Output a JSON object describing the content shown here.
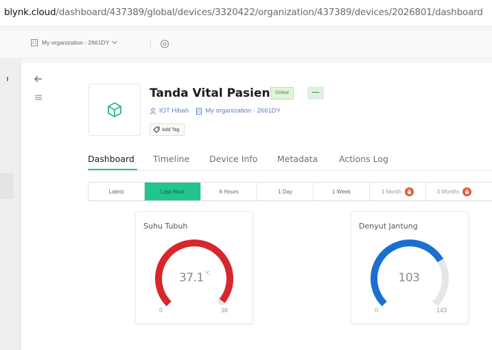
{
  "browser": {
    "url_host": "blynk.cloud",
    "url_path": "/dashboard/437389/global/devices/3320422/organization/437389/devices/2026801/dashboard"
  },
  "org_bar": {
    "org_name": "My organization - 2661DY",
    "icons": [
      "building-icon",
      "chevron-down-icon",
      "settings-icon"
    ]
  },
  "sidebar": {
    "icons": [
      "back-arrow-icon",
      "menu-icon"
    ]
  },
  "device": {
    "title": "Tanda Vital Pasien",
    "status": "Online",
    "more_label": "—",
    "owner": "IOT Hibah",
    "organization": "My organization - 2661DY",
    "add_tag_label": "Add Tag",
    "icon": "cube-icon"
  },
  "tabs": [
    {
      "label": "Dashboard",
      "active": true
    },
    {
      "label": "Timeline"
    },
    {
      "label": "Device Info"
    },
    {
      "label": "Metadata"
    },
    {
      "label": "Actions Log"
    }
  ],
  "time_ranges": [
    {
      "label": "Latest"
    },
    {
      "label": "Last Hour",
      "active": true
    },
    {
      "label": "6 Hours"
    },
    {
      "label": "1 Day"
    },
    {
      "label": "1 Week"
    },
    {
      "label": "1 Month",
      "locked": true
    },
    {
      "label": "3 Months",
      "locked": true
    }
  ],
  "widgets": [
    {
      "title": "Suhu Tubuh",
      "value": "37.1",
      "unit": "°C",
      "numeric_value": 37.1,
      "min": "0",
      "max": "38",
      "min_value": 0,
      "max_value": 38,
      "color": "#d7262c"
    },
    {
      "title": "Denyut Jantung",
      "value": "103",
      "unit": "",
      "numeric_value": 103,
      "min": "0",
      "max": "143",
      "min_value": 0,
      "max_value": 143,
      "color": "#1c6fd1"
    }
  ],
  "colors": {
    "accent": "#23c48e",
    "link": "#5b7fc4",
    "online_badge": "#e3f4db",
    "lock_badge": "#e05a3a"
  }
}
